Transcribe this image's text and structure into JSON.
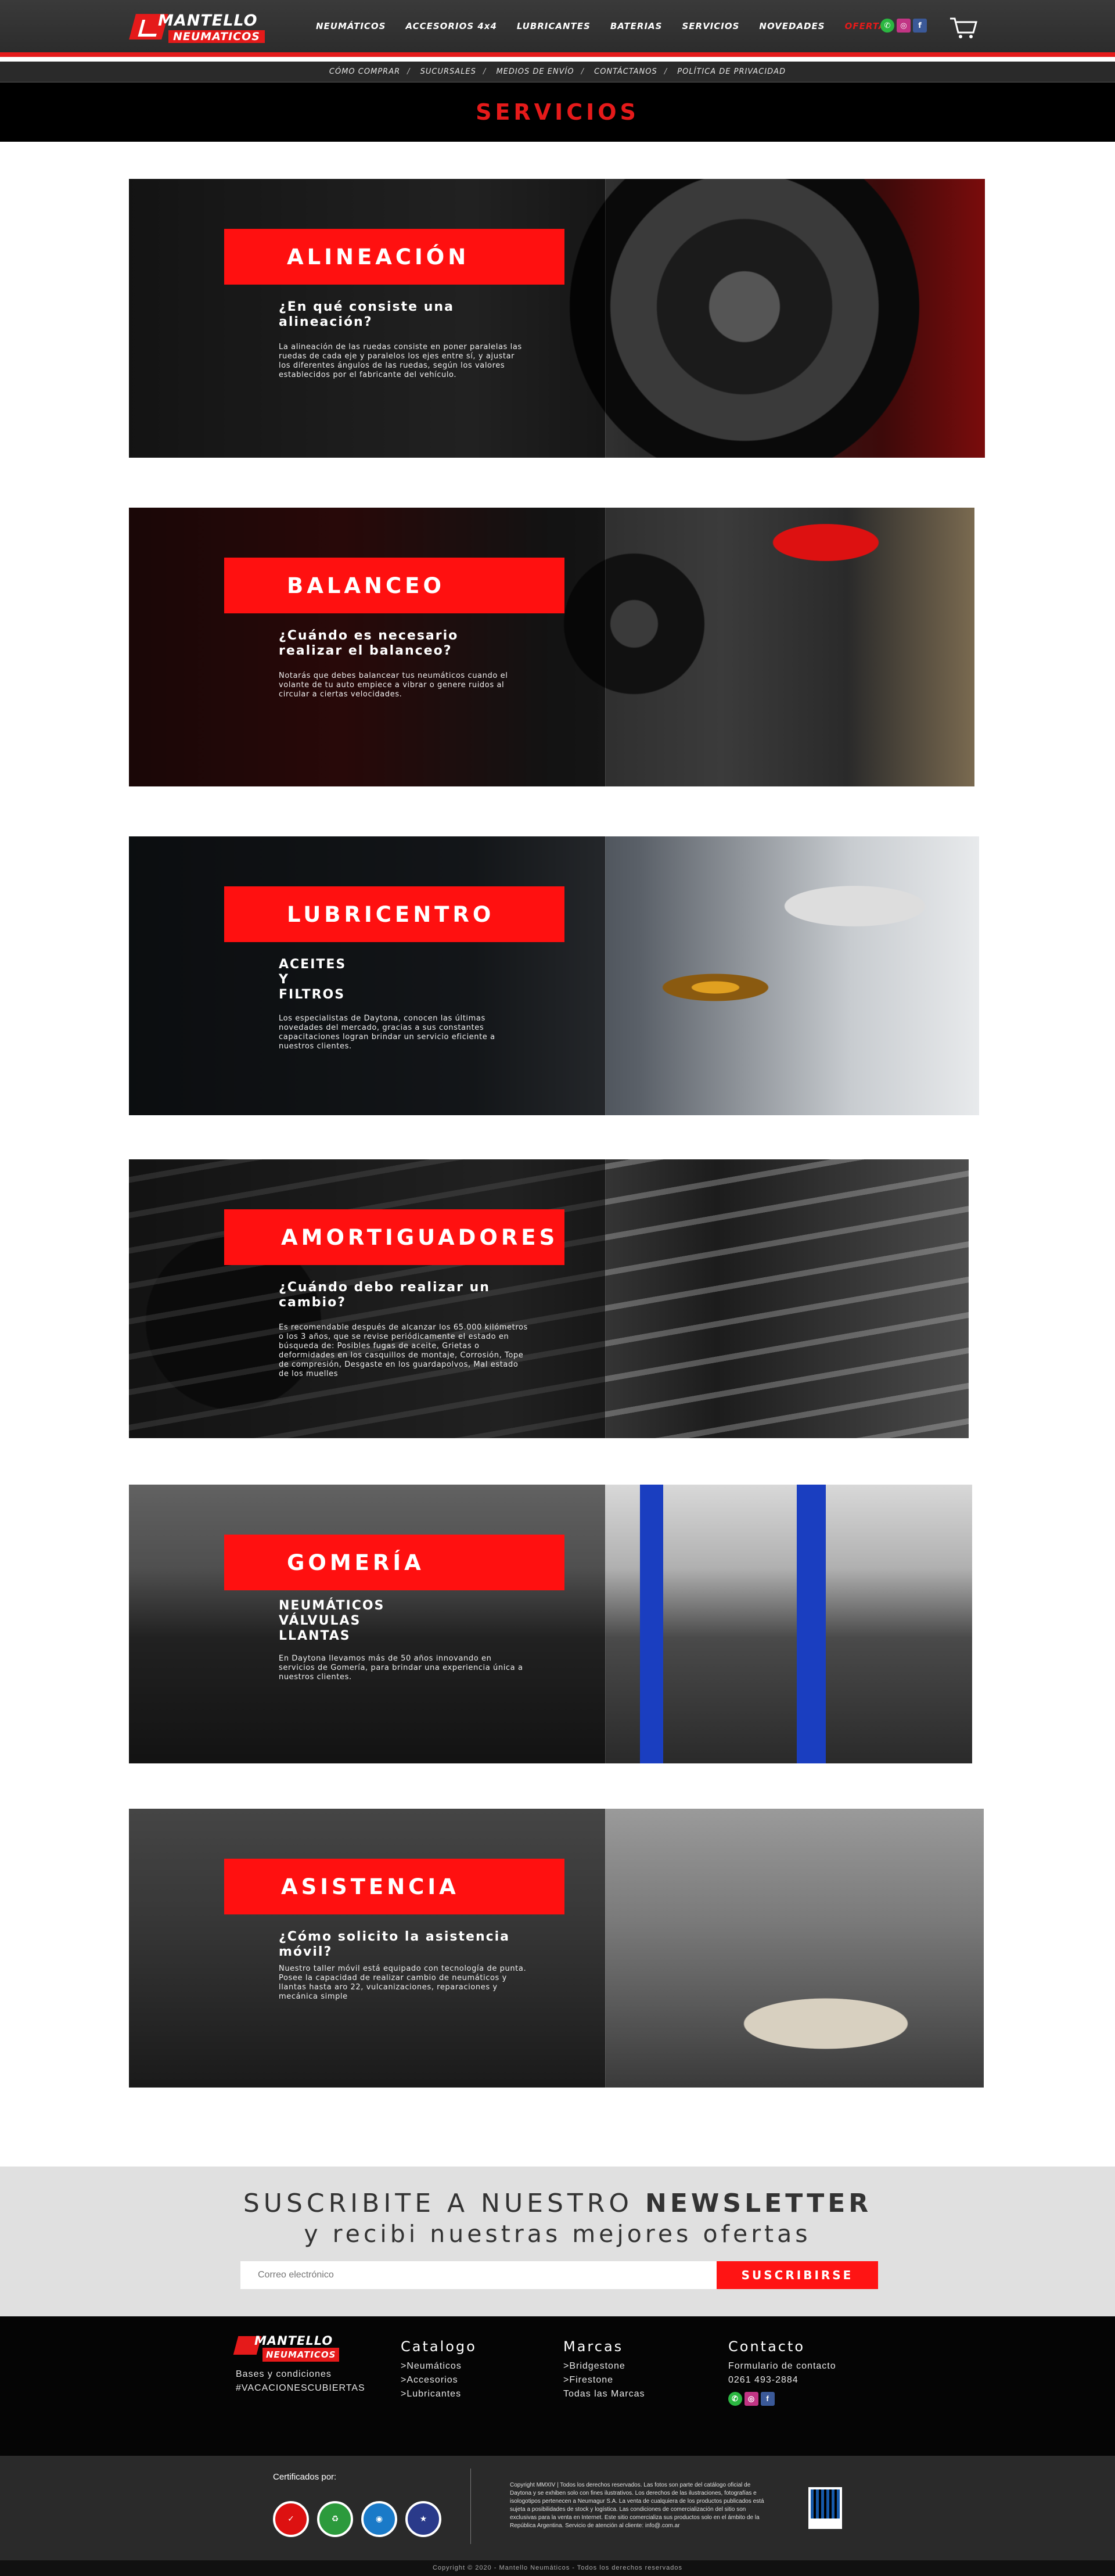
{
  "header": {
    "logo_line1": "MANTELLO",
    "logo_line2": "NEUMATICOS",
    "nav": [
      "NEUMÁTICOS",
      "ACCESORIOS 4x4",
      "LUBRICANTES",
      "BATERIAS",
      "SERVICIOS",
      "NOVEDADES",
      "OFERTAS"
    ],
    "social": [
      "whatsapp-icon",
      "instagram-icon",
      "facebook-icon"
    ],
    "cart_icon": "cart-icon"
  },
  "subnav": [
    "CÓMO COMPRAR",
    "SUCURSALES",
    "MEDIOS DE ENVÍO",
    "CONTÁCTANOS",
    "POLÍTICA DE PRIVACIDAD"
  ],
  "page_title": "SERVICIOS",
  "services": [
    {
      "title": "ALINEACIÓN",
      "heading": "¿En qué consiste una alineación?",
      "text": "La alineación de las ruedas consiste en poner paralelas las ruedas de cada eje y paralelos los ejes entre sí, y ajustar los diferentes ángulos de las ruedas, según los valores establecidos por el fabricante del vehículo."
    },
    {
      "title": "BALANCEO",
      "heading": "¿Cuándo es necesario realizar el balanceo?",
      "text": "Notarás que debes balancear tus neumáticos cuando el volante de tu auto empiece a vibrar o genere ruidos al circular a ciertas velocidades."
    },
    {
      "title": "LUBRICENTRO",
      "heading": "ACEITES\nY\nFILTROS",
      "text": "Los especialistas de Daytona, conocen las últimas novedades del mercado, gracias a sus constantes capacitaciones logran brindar un servicio eficiente a nuestros clientes."
    },
    {
      "title": "AMORTIGUADORES",
      "heading": "¿Cuándo debo realizar un cambio?",
      "text": "Es recomendable después de alcanzar los 65.000 kilómetros o los 3 años, que se revise periódicamente el estado en búsqueda de: Posibles fugas de aceite, Grietas o deformidades en los casquillos de montaje, Corrosión, Tope de compresión, Desgaste en los guardapolvos, Mal estado de los muelles"
    },
    {
      "title": "GOMERÍA",
      "heading": "NEUMÁTICOS\nVÁLVULAS\nLLANTAS",
      "text": "En Daytona llevamos más de 50 años innovando en servicios de Gomería, para brindar una experiencia única a nuestros clientes."
    },
    {
      "title": "ASISTENCIA",
      "heading": "¿Cómo solicito la asistencia móvil?",
      "text": "Nuestro taller móvil está equipado con tecnología de punta. Posee la capacidad de realizar cambio de neumáticos y llantas hasta aro 22, vulcanizaciones, reparaciones y mecánica simple"
    }
  ],
  "newsletter": {
    "line1_prefix": "SUSCRIBITE A NUESTRO",
    "line1_bold": "NEWSLETTER",
    "line2": "y recibi nuestras mejores ofertas",
    "placeholder": "Correo electrónico",
    "button": "SUSCRIBIRSE"
  },
  "footer": {
    "col1": [
      "Bases y condiciones",
      "#VACACIONESCUBIERTAS"
    ],
    "catalogo_title": "Catalogo",
    "catalogo": [
      ">Neumáticos",
      ">Accesorios",
      ">Lubricantes"
    ],
    "marcas_title": "Marcas",
    "marcas": [
      ">Bridgestone",
      ">Firestone",
      "Todas las Marcas"
    ],
    "contacto_title": "Contacto",
    "contacto": [
      "Formulario de contacto",
      "0261 493-2884"
    ]
  },
  "certified": {
    "label": "Certificados por:",
    "legal": "Copyright MMXIV | Todos los derechos reservados. Las fotos son parte del catálogo oficial de Daytona y se exhiben solo con fines ilustrativos. Los derechos de las ilustraciones, fotografías e isologotipos pertenecen a Neumagur S.A. La venta de cualquiera de los productos publicados está sujeta a posibilidades de stock y logística. Las condiciones de comercialización del sitio son exclusivas para la venta en Internet. Este sitio comercializa sus productos solo en el ámbito de la República Argentina. Servicio de atención al cliente: info@.com.ar"
  },
  "copyright": "Copyright © 2020 - Mantello Neumáticos - Todos los derechos reservados",
  "colors": {
    "accent": "#e51a1a",
    "dark": "#000000",
    "newsletter_bg": "#e0e0e0"
  }
}
